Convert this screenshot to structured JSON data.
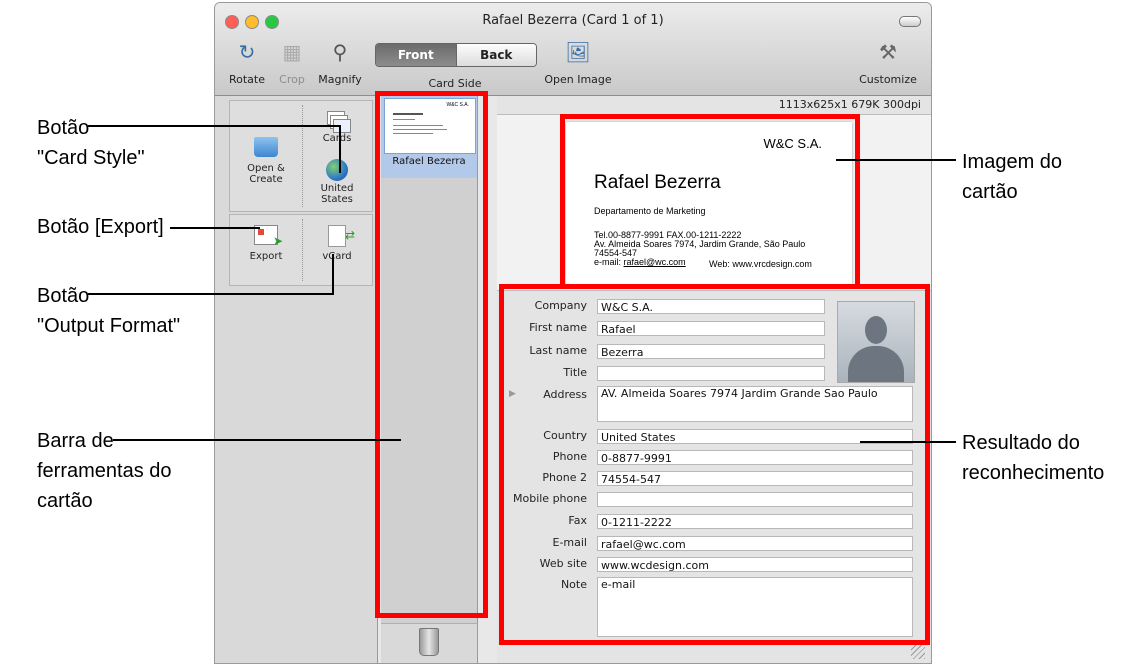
{
  "window": {
    "title": "Rafael Bezerra (Card 1 of 1)",
    "traffic_lights": [
      "#ff5f57",
      "#ffbd2e",
      "#28c940"
    ]
  },
  "toolbar": {
    "rotate": "Rotate",
    "crop": "Crop",
    "magnify": "Magnify",
    "card_side_label": "Card Side",
    "front": "Front",
    "back": "Back",
    "open_image": "Open Image",
    "customize": "Customize"
  },
  "left_toolbar": {
    "open_create": "Open &\nCreate",
    "cards": "Cards",
    "country": "United States",
    "export": "Export",
    "vcard": "vCard"
  },
  "thumbnail": {
    "label": "Rafael Bezerra"
  },
  "image_info": "1113x625x1  679K  300dpi",
  "card_image": {
    "company": "W&C S.A.",
    "name": "Rafael Bezerra",
    "department": "Departamento de Marketing",
    "tel_fax": "Tel.00-8877-9991   FAX.00-1211-2222",
    "address": "Av. Almeida Soares 7974, Jardim Grande, São Paulo",
    "zip": "74554-547",
    "email_prefix": "e-mail: ",
    "email": "rafael@wc.com",
    "web": "Web: www.vrcdesign.com"
  },
  "form": {
    "company": {
      "label": "Company",
      "value": "W&C S.A."
    },
    "first_name": {
      "label": "First name",
      "value": "Rafael"
    },
    "last_name": {
      "label": "Last name",
      "value": "Bezerra"
    },
    "title": {
      "label": "Title",
      "value": ""
    },
    "address": {
      "label": "Address",
      "value": "AV. Almeida Soares 7974 Jardim Grande Sao Paulo"
    },
    "country": {
      "label": "Country",
      "value": "United States"
    },
    "phone": {
      "label": "Phone",
      "value": "0-8877-9991"
    },
    "phone2": {
      "label": "Phone 2",
      "value": "74554-547"
    },
    "mobile": {
      "label": "Mobile phone",
      "value": ""
    },
    "fax": {
      "label": "Fax",
      "value": "0-1211-2222"
    },
    "email": {
      "label": "E-mail",
      "value": "rafael@wc.com"
    },
    "website": {
      "label": "Web site",
      "value": "www.wcdesign.com"
    },
    "note": {
      "label": "Note",
      "value": "e-mail"
    }
  },
  "annotations": {
    "card_style_1": "Botão",
    "card_style_2": "\"Card Style\"",
    "export": "Botão [Export]",
    "output_format_1": "Botão",
    "output_format_2": "\"Output Format\"",
    "card_toolbar_1": "Barra de",
    "card_toolbar_2": "ferramentas do",
    "card_toolbar_3": "cartão",
    "card_image_1": "Imagem do",
    "card_image_2": "cartão",
    "recognition_1": "Resultado do",
    "recognition_2": "reconhecimento",
    "highlight_color": "#ff0000"
  }
}
